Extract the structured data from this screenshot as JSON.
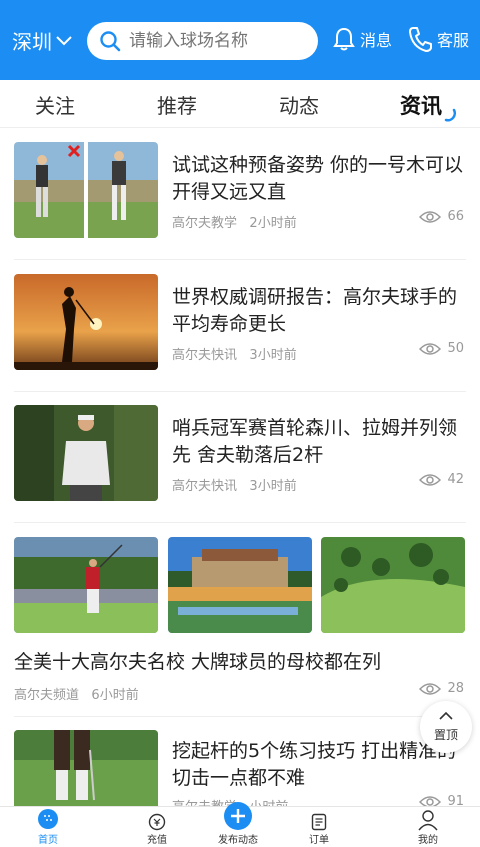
{
  "header": {
    "city": "深圳",
    "search_placeholder": "请输入球场名称",
    "messages_label": "消息",
    "service_label": "客服"
  },
  "tabs": [
    {
      "label": "关注"
    },
    {
      "label": "推荐"
    },
    {
      "label": "动态"
    },
    {
      "label": "资讯",
      "active": true
    }
  ],
  "articles": [
    {
      "title": "试试这种预备姿势 你的一号木可以开得又远又直",
      "source": "高尔夫教学",
      "time": "2小时前",
      "views": "66"
    },
    {
      "title": "世界权威调研报告：高尔夫球手的平均寿命更长",
      "source": "高尔夫快讯",
      "time": "3小时前",
      "views": "50"
    },
    {
      "title": "哨兵冠军赛首轮森川、拉姆并列领先 舍夫勒落后2杆",
      "source": "高尔夫快讯",
      "time": "3小时前",
      "views": "42"
    },
    {
      "title": "全美十大高尔夫名校 大牌球员的母校都在列",
      "source": "高尔夫频道",
      "time": "6小时前",
      "views": "28"
    },
    {
      "title": "挖起杆的5个练习技巧 打出精准的切击一点都不难",
      "source": "高尔夫教学",
      "time": "小时前",
      "views": "91"
    }
  ],
  "back_to_top": "置顶",
  "bottom_nav": [
    {
      "label": "首页",
      "active": true
    },
    {
      "label": "充值"
    },
    {
      "label": "发布动态"
    },
    {
      "label": "订单"
    },
    {
      "label": "我的"
    }
  ],
  "colors": {
    "brand": "#1c8ef3",
    "text": "#222222",
    "muted": "#999999"
  }
}
